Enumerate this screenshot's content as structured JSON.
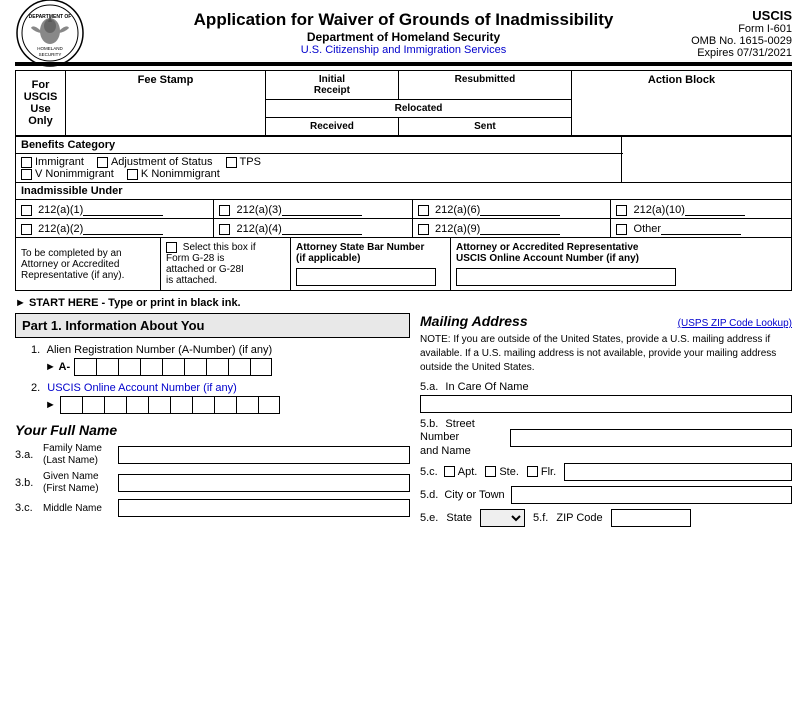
{
  "header": {
    "title": "Application for Waiver of Grounds of Inadmissibility",
    "agency": "Department of Homeland Security",
    "sub_agency": "U.S. Citizenship and Immigration Services",
    "form_name": "USCIS",
    "form_id": "Form I-601",
    "omb": "OMB No. 1615-0029",
    "expires": "Expires 07/31/2021"
  },
  "top_table": {
    "uscis_use": "For\nUSCIS\nUse\nOnly",
    "fee_stamp": "Fee Stamp",
    "initial_receipt": "Initial\nReceipt",
    "resubmitted": "Resubmitted",
    "action_block": "Action Block",
    "relocated": "Relocated",
    "received": "Received",
    "sent": "Sent"
  },
  "benefits": {
    "label": "Benefits Category",
    "options": [
      "Immigrant",
      "Adjustment of Status",
      "TPS",
      "V Nonimmigrant",
      "K Nonimmigrant"
    ]
  },
  "inadmissible": {
    "label": "Inadmissible Under",
    "codes": [
      "212(a)(1)",
      "212(a)(3)",
      "212(a)(6)",
      "212(a)(10)",
      "212(a)(2)",
      "212(a)(4)",
      "212(a)(9)",
      "Other"
    ]
  },
  "attorney": {
    "to_be_completed": "To be completed\nby an Attorney\nor Accredited\nRepresentative (if any).",
    "checkbox_label": "Select this box if\nForm G-28 is\nattached or G-28I\nis attached.",
    "bar_number_label": "Attorney State Bar Number\n(if applicable)",
    "online_account_label": "Attorney or Accredited Representative\nUSCIS Online Account Number (if any)"
  },
  "start_here": "► START HERE - Type or print in black ink.",
  "part1": {
    "header": "Part 1.  Information About You",
    "field1_label": "Alien Registration Number (A-Number) (if any)",
    "field1_prefix": "► A-",
    "field2_label": "USCIS Online Account Number (if any)",
    "field2_prefix": "►",
    "full_name_header": "Your Full Name",
    "field3a_num": "3.a.",
    "field3a_label": "Family Name\n(Last Name)",
    "field3b_num": "3.b.",
    "field3b_label": "Given Name\n(First Name)",
    "field3c_num": "3.c.",
    "field3c_label": "Middle Name"
  },
  "mailing": {
    "header": "Mailing Address",
    "zip_lookup": "(USPS ZIP Code Lookup)",
    "note": "NOTE: If you are outside of the United States, provide a U.S. mailing address if available. If a U.S. mailing address is not available, provide your mailing address outside the United States.",
    "field5a_label": "5.a.",
    "field5a_name": "In Care Of Name",
    "field5b_label": "5.b.",
    "field5b_name": "Street Number\nand Name",
    "field5c_label": "5.c.",
    "field5c_apt": "Apt.",
    "field5c_ste": "Ste.",
    "field5c_flr": "Flr.",
    "field5d_label": "5.d.",
    "field5d_name": "City or Town",
    "field5e_label": "5.e.",
    "field5e_name": "State",
    "field5f_label": "5.f.",
    "field5f_name": "ZIP Code"
  }
}
